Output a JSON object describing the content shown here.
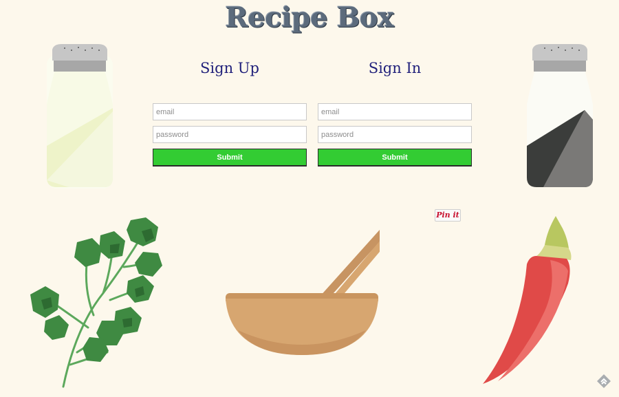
{
  "header": {
    "title": "Recipe Box"
  },
  "signup": {
    "heading": "Sign Up",
    "email_placeholder": "email",
    "password_placeholder": "password",
    "submit_label": "Submit"
  },
  "signin": {
    "heading": "Sign In",
    "email_placeholder": "email",
    "password_placeholder": "password",
    "submit_label": "Submit"
  },
  "pinterest": {
    "label": "Pin it"
  },
  "colors": {
    "background": "#fdf8ec",
    "title": "#5c6b7c",
    "heading": "#1f1f7a",
    "submit": "#33cc33"
  },
  "icons": [
    "salt-shaker-icon",
    "pepper-shaker-icon",
    "parsley-icon",
    "mixing-bowl-icon",
    "chili-pepper-icon",
    "feedly-icon"
  ]
}
